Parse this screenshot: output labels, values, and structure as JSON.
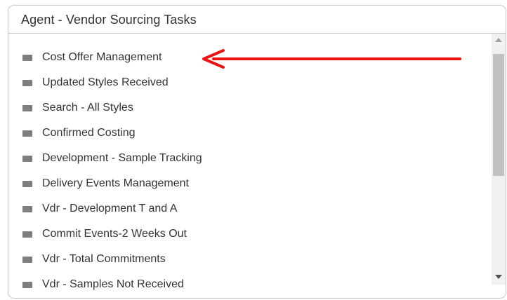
{
  "panel": {
    "title": "Agent - Vendor Sourcing Tasks"
  },
  "list": {
    "items": [
      {
        "label": "Cost Offer Management",
        "icon": "folder-tab-icon"
      },
      {
        "label": "Updated Styles Received",
        "icon": "folder-tab-icon"
      },
      {
        "label": "Search - All Styles",
        "icon": "folder-tab-icon"
      },
      {
        "label": "Confirmed Costing",
        "icon": "folder-tab-icon"
      },
      {
        "label": "Development - Sample Tracking",
        "icon": "folder-tab-icon"
      },
      {
        "label": "Delivery Events Management",
        "icon": "folder-tab-icon"
      },
      {
        "label": "Vdr - Development T and A",
        "icon": "folder-tab-icon"
      },
      {
        "label": "Commit Events-2 Weeks Out",
        "icon": "folder-tab-icon"
      },
      {
        "label": "Vdr - Total Commitments",
        "icon": "folder-tab-icon"
      },
      {
        "label": "Vdr - Samples Not Received",
        "icon": "folder-tab-icon"
      }
    ]
  },
  "scrollbar": {
    "position_fraction": 0.0
  },
  "colors": {
    "annotation_arrow": "#ee1111",
    "icon": "#7e7e7e",
    "text": "#333333",
    "border": "#c9c9c9"
  }
}
